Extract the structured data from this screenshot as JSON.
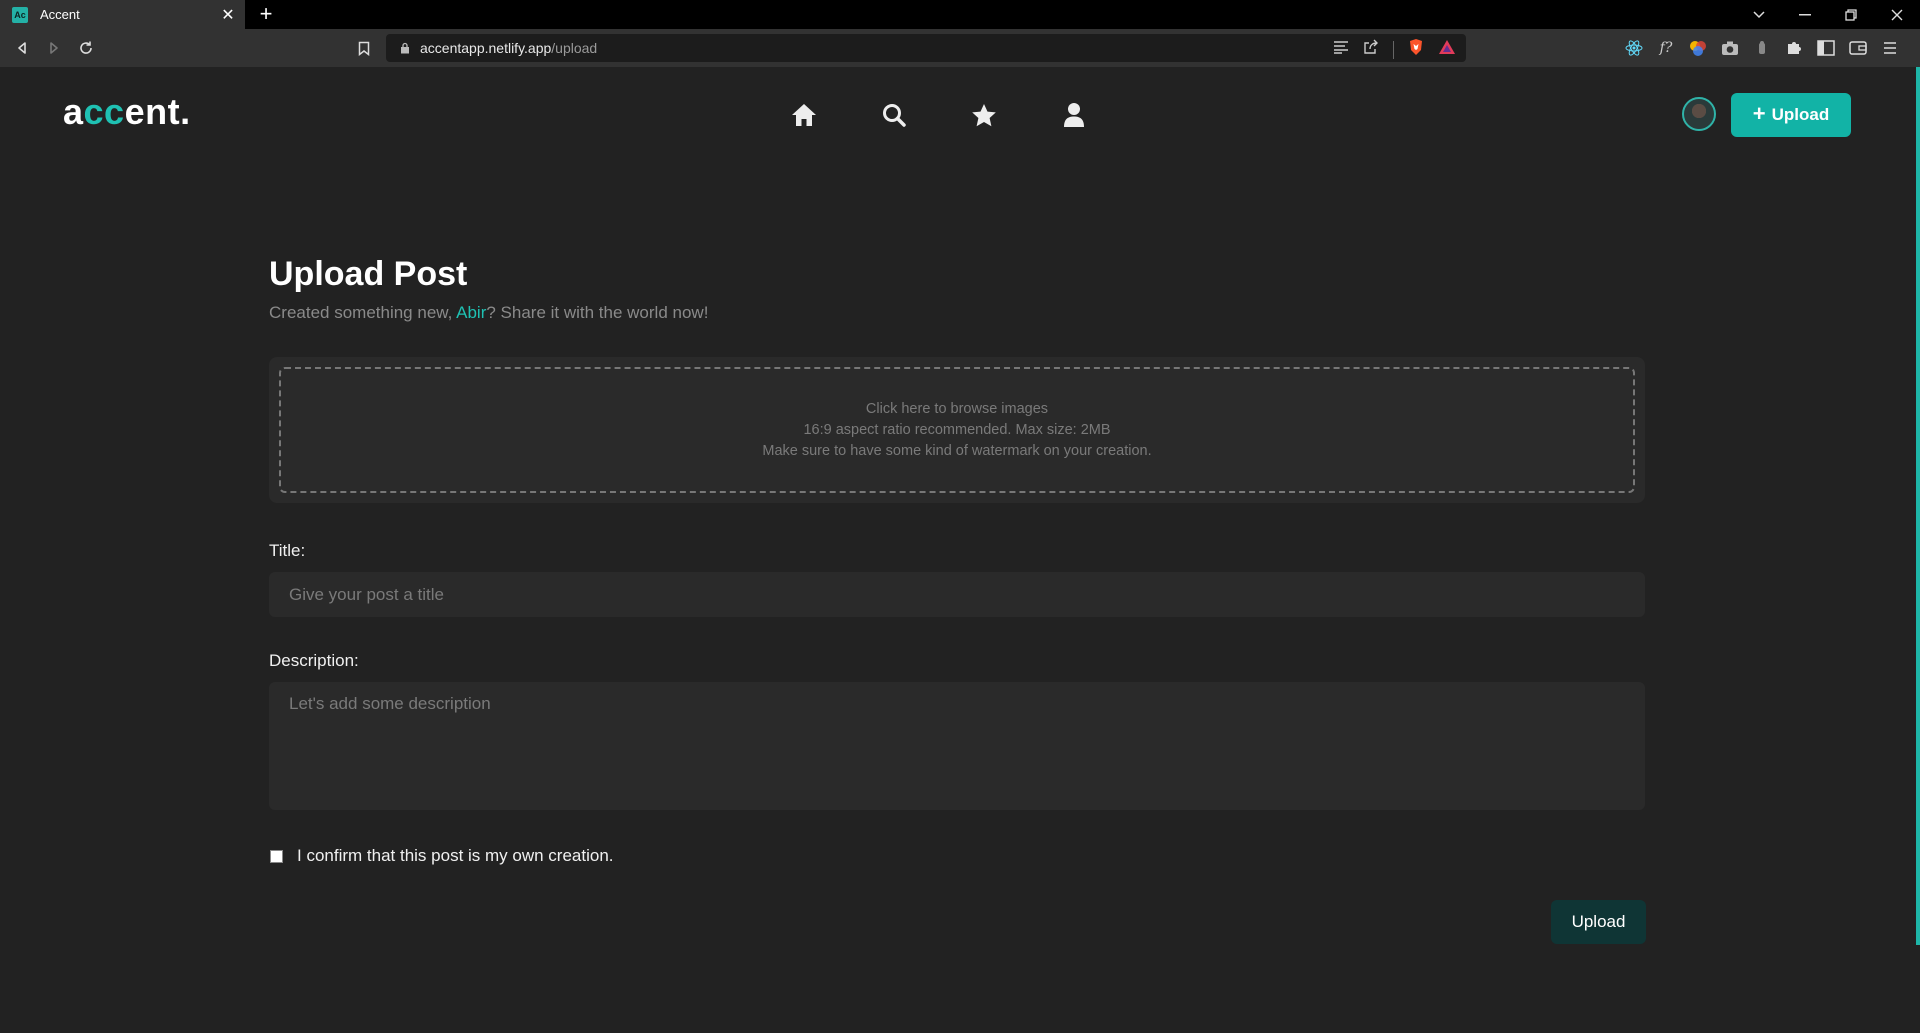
{
  "browser": {
    "tab_title": "Accent",
    "tab_favicon": "Ac",
    "tab_close": "✕",
    "new_tab": "+",
    "url_host": "accentapp.netlify.app",
    "url_path": "/upload",
    "window_controls": [
      "chevron-down",
      "minimize",
      "restore",
      "close"
    ]
  },
  "app": {
    "logo_part1": "a",
    "logo_accent": "cc",
    "logo_part2": "ent.",
    "brand_color": "#1fc1b3",
    "nav_icons": [
      "home-icon",
      "search-icon",
      "star-icon",
      "user-icon"
    ],
    "upload_button_label": "Upload"
  },
  "main": {
    "title": "Upload Post",
    "subtitle_before": "Created something new, ",
    "subtitle_name": "Abir",
    "subtitle_after": "? Share it with the world now!",
    "dropzone": {
      "line1": "Click here to browse images",
      "line2": "16:9 aspect ratio recommended. Max size: 2MB",
      "line3": "Make sure to have some kind of watermark on your creation."
    },
    "title_label": "Title:",
    "title_placeholder": "Give your post a title",
    "description_label": "Description:",
    "description_placeholder": "Let's add some description",
    "confirm_text": "I confirm that this post is my own creation.",
    "submit_label": "Upload"
  }
}
